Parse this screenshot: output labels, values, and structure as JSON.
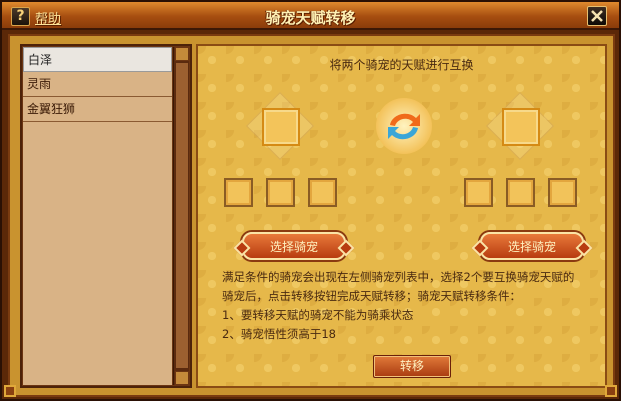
{
  "window": {
    "title": "骑宠天赋转移",
    "help_icon": "?",
    "help_label": "帮助",
    "close_icon": "close-icon"
  },
  "pet_list": {
    "items": [
      {
        "label": "白泽",
        "selected": true
      },
      {
        "label": "灵雨",
        "selected": false
      },
      {
        "label": "金翼狂狮",
        "selected": false
      }
    ]
  },
  "swap_panel": {
    "title": "将两个骑宠的天赋进行互换",
    "swap_icon": "swap-arrows-icon",
    "left_select_label": "选择骑宠",
    "right_select_label": "选择骑宠"
  },
  "description": {
    "line1": "满足条件的骑宠会出现在左侧骑宠列表中，选择2个要互换骑宠天赋的",
    "line2": "骑宠后，点击转移按钮完成天赋转移；骑宠天赋转移条件：",
    "line3": "1、要转移天赋的骑宠不能为骑乘状态",
    "line4": "2、骑宠悟性须高于18"
  },
  "transfer_button": "转移",
  "colors": {
    "title_bar": "#a74e10",
    "panel_bg": "#e6b84a",
    "button": "#b83c10",
    "swap_orange": "#f06a1a",
    "swap_blue": "#3aa6d8"
  }
}
